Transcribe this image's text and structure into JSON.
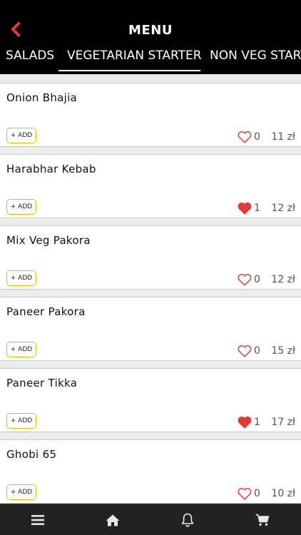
{
  "header": {
    "title": "MENU",
    "back_icon": "chevron-left-icon",
    "back_icon_color": "#e53935"
  },
  "tabs": [
    {
      "label": "SALADS",
      "active": false
    },
    {
      "label": "VEGETARIAN STARTER",
      "active": true
    },
    {
      "label": "NON VEG START",
      "active": false
    }
  ],
  "items": [
    {
      "name": "Onion Bhajia",
      "add_label": "+ ADD",
      "likes": "0",
      "liked": false,
      "price": "11 zł"
    },
    {
      "name": "Harabhar Kebab",
      "add_label": "+ ADD",
      "likes": "1",
      "liked": true,
      "price": "12 zł"
    },
    {
      "name": "Mix Veg Pakora",
      "add_label": "+ ADD",
      "likes": "0",
      "liked": false,
      "price": "12 zł"
    },
    {
      "name": "Paneer Pakora",
      "add_label": "+ ADD",
      "likes": "0",
      "liked": false,
      "price": "15 zł"
    },
    {
      "name": "Paneer Tikka",
      "add_label": "+ ADD",
      "likes": "1",
      "liked": true,
      "price": "17 zł"
    },
    {
      "name": "Ghobi 65",
      "add_label": "+ ADD",
      "likes": "0",
      "liked": false,
      "price": "10 zł"
    }
  ],
  "footer": {
    "nav": [
      "menu-icon",
      "home-icon",
      "bell-icon",
      "cart-icon"
    ]
  },
  "colors": {
    "accent_red": "#e53935",
    "add_border": "#e6b800",
    "header_bg": "#000000",
    "footer_bg": "#222222"
  }
}
